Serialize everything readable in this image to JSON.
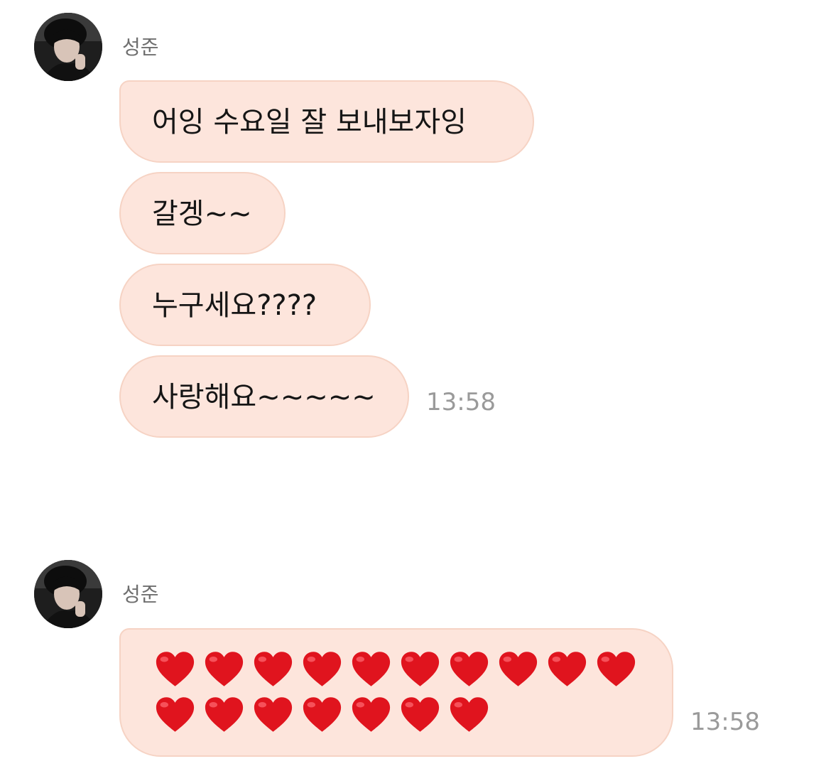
{
  "chat": {
    "groups": [
      {
        "sender": "성준",
        "messages": [
          "어잉 수요일 잘 보내보자잉",
          "갈겡~~",
          "누구세요????",
          "사랑해요~~~~~"
        ],
        "time": "13:58"
      },
      {
        "sender": "성준",
        "heart_count": 17,
        "heart_emoji": "❤️",
        "time": "13:58"
      }
    ]
  },
  "colors": {
    "bubble": "#fde5dc",
    "bubble_border": "#f6d3c4",
    "heart": "#e0141e",
    "time": "#9a9a9a",
    "sender": "#6f6f6f"
  }
}
